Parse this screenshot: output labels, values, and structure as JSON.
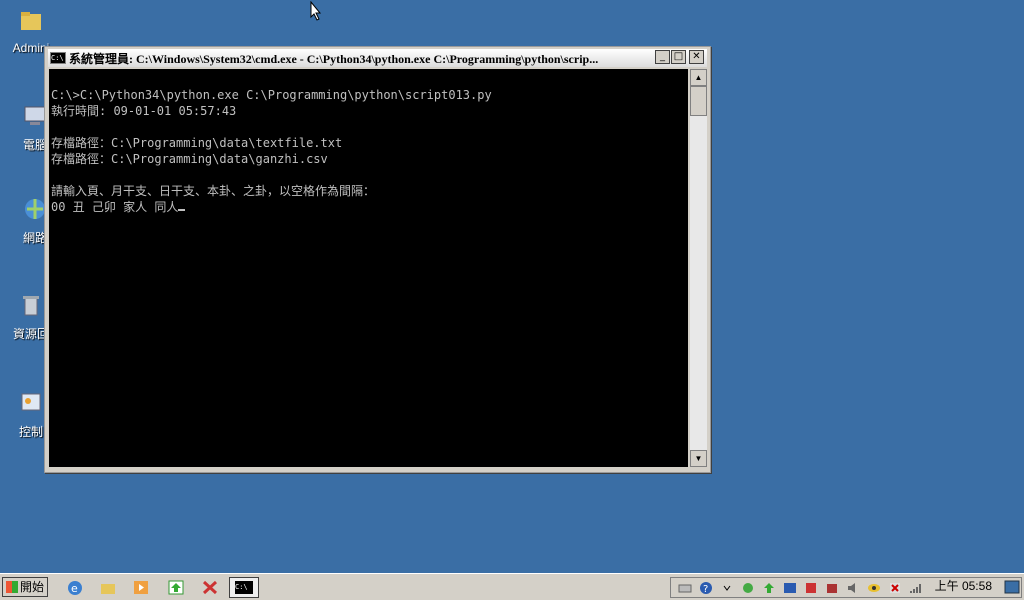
{
  "desktop": {
    "icons": [
      {
        "label": "Admini"
      },
      {
        "label": "電腦"
      },
      {
        "label": "網路"
      },
      {
        "label": "資源回"
      },
      {
        "label": "控制"
      }
    ]
  },
  "window": {
    "title": "系統管理員: C:\\Windows\\System32\\cmd.exe - C:\\Python34\\python.exe  C:\\Programming\\python\\scrip...",
    "console_lines": [
      "C:\\>C:\\Python34\\python.exe C:\\Programming\\python\\script013.py",
      "執行時間: 09-01-01 05:57:43",
      "",
      "存檔路徑：C:\\Programming\\data\\textfile.txt",
      "存檔路徑：C:\\Programming\\data\\ganzhi.csv",
      "",
      "請輸入頁、月干支、日干支、本卦、之卦，以空格作為間隔：",
      "00 丑 己卯 家人 同人"
    ],
    "buttons": {
      "minimize": "_",
      "maximize": "□",
      "close": "✕"
    }
  },
  "taskbar": {
    "start_label": "開始",
    "clock": "上午 05:58"
  },
  "colors": {
    "desktop": "#3a6ea5",
    "console_bg": "#000000",
    "console_fg": "#c0c0c0"
  }
}
